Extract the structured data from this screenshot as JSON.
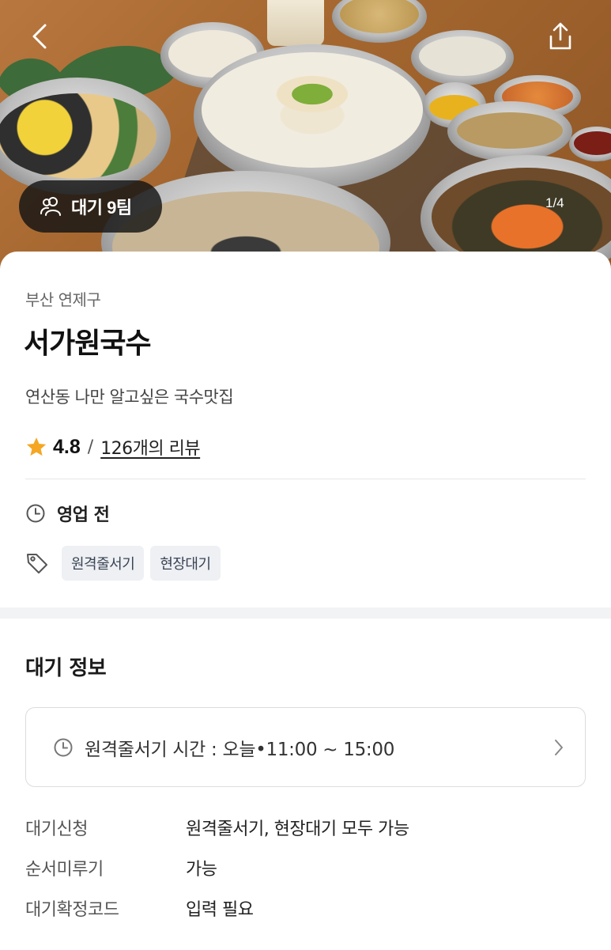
{
  "hero": {
    "back_icon": "chevron-left-icon",
    "share_icon": "share-icon",
    "wait_badge": {
      "icon": "people-icon",
      "label": "대기 9팀"
    },
    "pager": "1/4"
  },
  "store": {
    "region": "부산 연제구",
    "name": "서가원국수",
    "description": "연산동 나만 알고싶은 국수맛집",
    "rating": "4.8",
    "rating_separator": "/",
    "reviews_link": "126개의 리뷰",
    "status": "영업 전",
    "tags": [
      "원격줄서기",
      "현장대기"
    ]
  },
  "waiting_info": {
    "title": "대기 정보",
    "remote_time": "원격줄서기 시간 : 오늘•11:00 ~ 15:00",
    "rows": [
      {
        "key": "대기신청",
        "value": "원격줄서기, 현장대기 모두 가능"
      },
      {
        "key": "순서미루기",
        "value": "가능"
      },
      {
        "key": "대기확정코드",
        "value": "입력 필요"
      }
    ]
  },
  "colors": {
    "star": "#f5a623",
    "badge_bg": "#141414",
    "tag_bg": "#eef0f4",
    "band": "#f2f3f5"
  }
}
